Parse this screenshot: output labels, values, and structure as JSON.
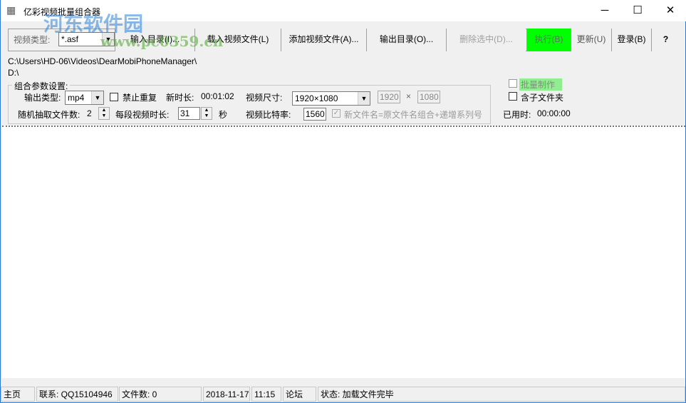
{
  "window": {
    "title": "亿彩视频批量组合器",
    "minimize": "─",
    "maximize": "☐",
    "close": "✕"
  },
  "toolbar": {
    "video_type_label": "视频类型:",
    "video_type_value": "*.asf",
    "buttons": [
      "输入目录(I)...",
      "载入视频文件(L)",
      "添加视频文件(A)...",
      "输出目录(O)...",
      "删除选中(D)...",
      "执行(B)",
      "更新(U)",
      "登录(B)",
      "?"
    ]
  },
  "paths": {
    "input": "C:\\Users\\HD-06\\Videos\\DearMobiPhoneManager\\",
    "output": "D:\\"
  },
  "settings": {
    "group_label": "组合参数设置:",
    "output_type_label": "输出类型:",
    "output_type_value": "mp4",
    "no_repeat_label": "禁止重复",
    "new_duration_label": "新时长:",
    "new_duration_value": "00:01:02",
    "video_size_label": "视频尺寸:",
    "video_size_value": "1920×1080",
    "width_value": "1920",
    "times": "×",
    "height_value": "1080",
    "random_files_label": "随机抽取文件数:",
    "random_files_value": "2",
    "segment_label": "每段视频时长:",
    "segment_value": "31",
    "segment_unit": "秒",
    "bitrate_label": "视频比特率:",
    "bitrate_value": "1560",
    "naming_label": "新文件名=原文件名组合+递增系列号"
  },
  "side": {
    "batch_label": "批量制作",
    "subfolder_label": "含子文件夹",
    "elapsed_label": "已用时:",
    "elapsed_value": "00:00:00"
  },
  "statusbar": {
    "home": "主页",
    "contact": "联系: QQ15104946",
    "file_count": "文件数: 0",
    "date": "2018-11-17",
    "time": "11:15",
    "forum": "论坛",
    "status": "状态: 加载文件完毕"
  },
  "watermark": {
    "name": "河东软件园",
    "url": "www.pc0359.cn"
  },
  "colors": {
    "run_button": "#00ff00",
    "batch_highlight": "#90ee90"
  }
}
